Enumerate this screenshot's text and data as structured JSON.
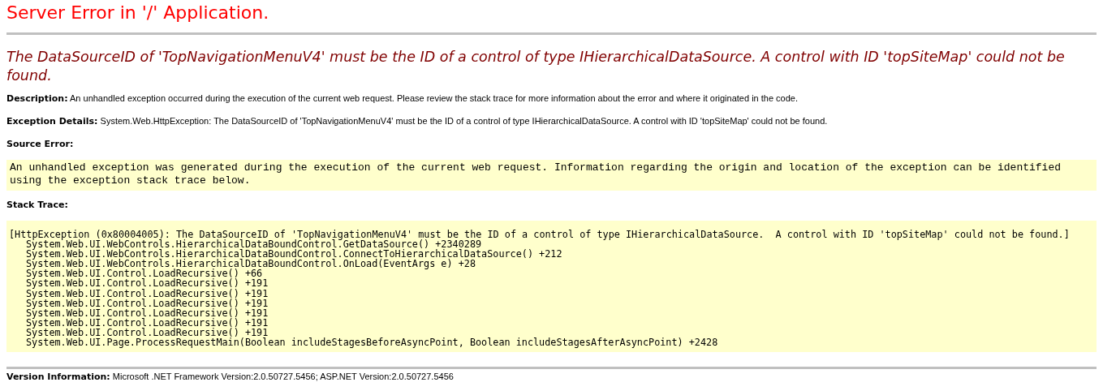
{
  "title": "Server Error in '/' Application.",
  "error_message": "The DataSourceID of 'TopNavigationMenuV4' must be the ID of a control of type IHierarchicalDataSource.  A control with ID 'topSiteMap' could not be found.",
  "description": {
    "label": "Description:",
    "text": "An unhandled exception occurred during the execution of the current web request. Please review the stack trace for more information about the error and where it originated in the code."
  },
  "exception_details": {
    "label": "Exception Details:",
    "text": "System.Web.HttpException: The DataSourceID of 'TopNavigationMenuV4' must be the ID of a control of type IHierarchicalDataSource.  A control with ID 'topSiteMap' could not be found."
  },
  "source_error": {
    "label": "Source Error:",
    "text": "An unhandled exception was generated during the execution of the current web request. Information regarding the origin and location of the exception can be identified using the exception stack trace below."
  },
  "stack_trace": {
    "label": "Stack Trace:",
    "exception": "[HttpException (0x80004005): The DataSourceID of 'TopNavigationMenuV4' must be the ID of a control of type IHierarchicalDataSource.  A control with ID 'topSiteMap' could not be found.]",
    "frames": [
      "System.Web.UI.WebControls.HierarchicalDataBoundControl.GetDataSource() +2340289",
      "System.Web.UI.WebControls.HierarchicalDataBoundControl.ConnectToHierarchicalDataSource() +212",
      "System.Web.UI.WebControls.HierarchicalDataBoundControl.OnLoad(EventArgs e) +28",
      "System.Web.UI.Control.LoadRecursive() +66",
      "System.Web.UI.Control.LoadRecursive() +191",
      "System.Web.UI.Control.LoadRecursive() +191",
      "System.Web.UI.Control.LoadRecursive() +191",
      "System.Web.UI.Control.LoadRecursive() +191",
      "System.Web.UI.Control.LoadRecursive() +191",
      "System.Web.UI.Control.LoadRecursive() +191",
      "System.Web.UI.Page.ProcessRequestMain(Boolean includeStagesBeforeAsyncPoint, Boolean includeStagesAfterAsyncPoint) +2428"
    ]
  },
  "version_information": {
    "label": "Version Information:",
    "text": "Microsoft .NET Framework Version:2.0.50727.5456; ASP.NET Version:2.0.50727.5456"
  }
}
